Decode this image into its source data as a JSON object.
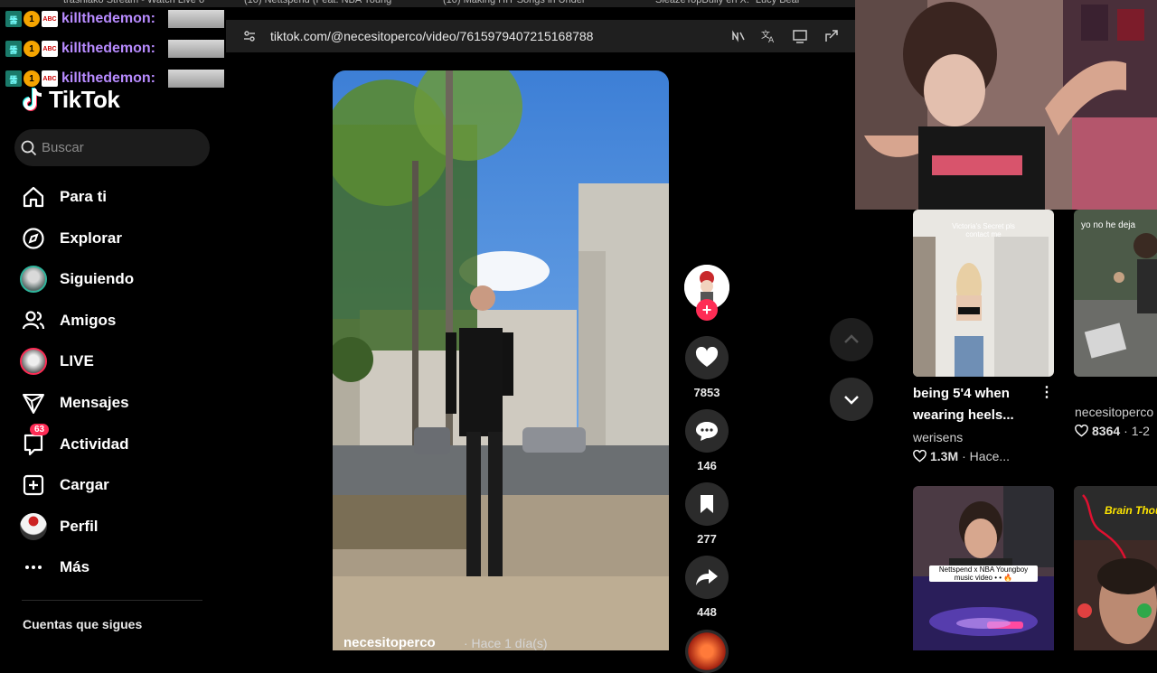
{
  "browser": {
    "tabs": [
      "trashiako Stream - Watch Live o",
      "(10) Nettspend (Feat. NBA Young",
      "(10) Making HIT Songs in Under",
      "SleazeTopBully en X: \"Lucy Bear"
    ],
    "url": "tiktok.com/@necesitoperco/video/7615979407215168788"
  },
  "chat": {
    "username": "killthedemon:",
    "badge_number": "1"
  },
  "sidebar": {
    "logo": "TikTok",
    "search_placeholder": "Buscar",
    "nav": [
      {
        "label": "Para ti",
        "icon": "home-icon"
      },
      {
        "label": "Explorar",
        "icon": "compass-icon"
      },
      {
        "label": "Siguiendo",
        "icon": "following-avatar"
      },
      {
        "label": "Amigos",
        "icon": "friends-icon"
      },
      {
        "label": "LIVE",
        "icon": "live-avatar"
      },
      {
        "label": "Mensajes",
        "icon": "paper-plane-icon"
      },
      {
        "label": "Actividad",
        "icon": "inbox-icon",
        "badge": "63"
      },
      {
        "label": "Cargar",
        "icon": "plus-square-icon"
      },
      {
        "label": "Perfil",
        "icon": "profile-avatar"
      },
      {
        "label": "Más",
        "icon": "more-icon"
      }
    ],
    "following_section_title": "Cuentas que sigues"
  },
  "video": {
    "author": "necesitoperco",
    "date": "· Hace 1 día(s)",
    "likes": "7853",
    "comments": "146",
    "saves": "277",
    "shares": "448"
  },
  "recommendations": [
    {
      "overlay_text": "Victoria's Secret pls contact me",
      "title": "being 5'4 when wearing heels...",
      "author": "werisens",
      "views": "1.3M",
      "age": "· Hace..."
    },
    {
      "overlay_text": "yo no he deja",
      "title": "",
      "author": "necesitoperco",
      "views": "8364",
      "age": "· 1-2"
    },
    {
      "overlay_text": "Nettspend x NBA Youngboy music video • • 🔥",
      "title": "",
      "author": "",
      "views": "",
      "age": ""
    },
    {
      "overlay_text": "Brain Thou",
      "title": "",
      "author": "",
      "views": "",
      "age": ""
    }
  ],
  "colors": {
    "accent": "#fe2c55",
    "chat_name": "#b88bff",
    "background": "#000000"
  }
}
